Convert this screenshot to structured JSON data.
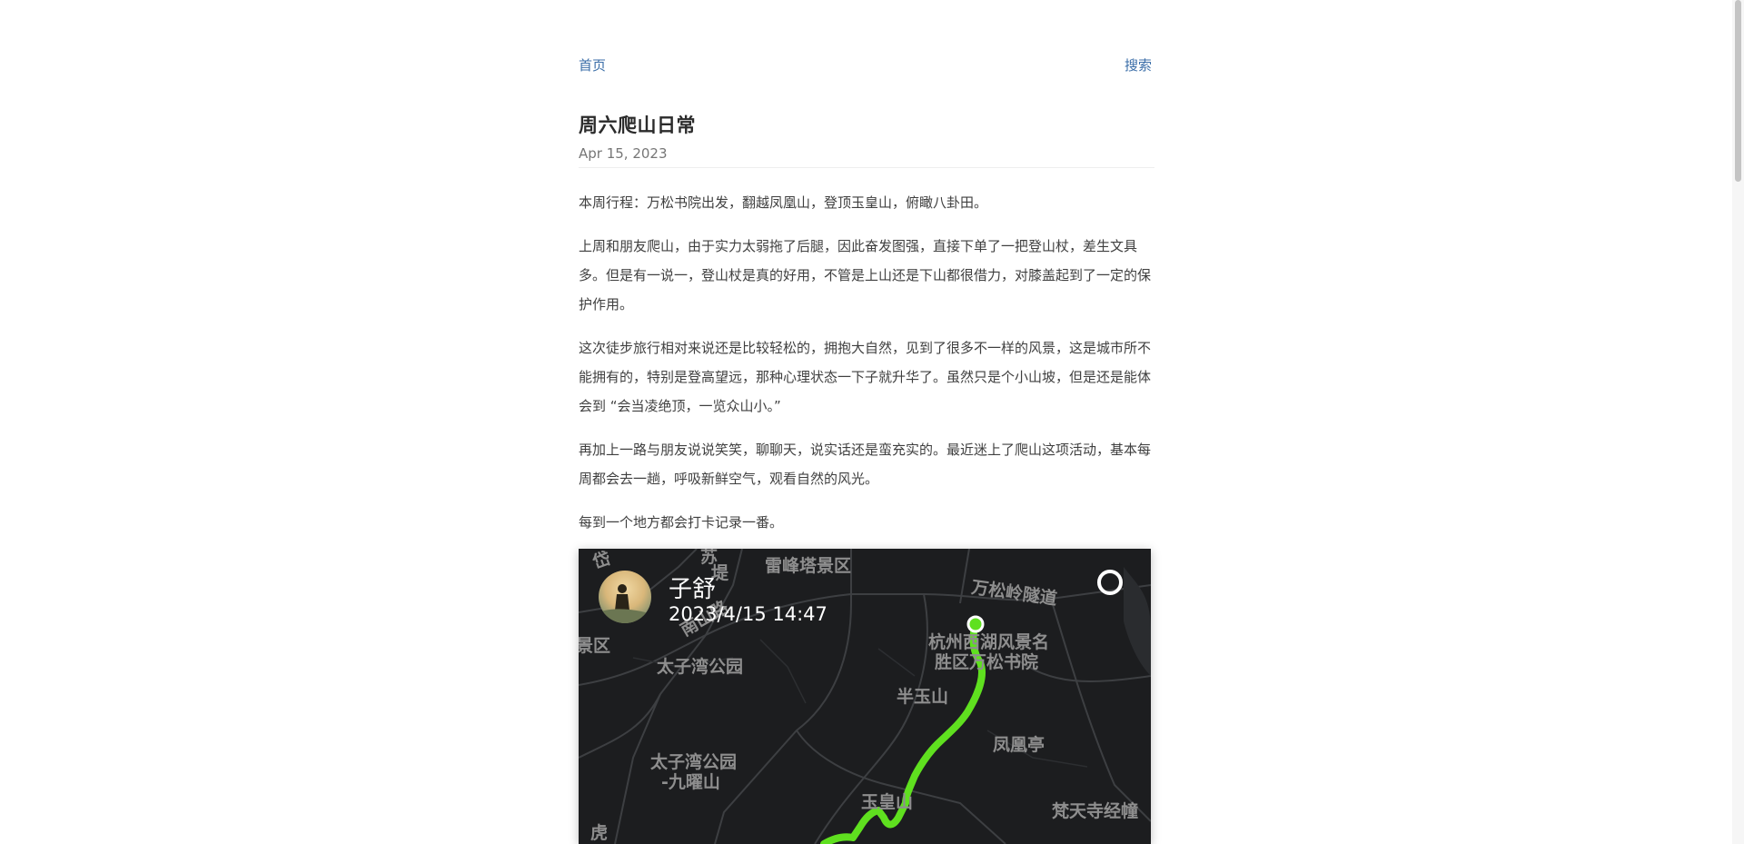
{
  "nav": {
    "home_label": "首页",
    "search_label": "搜索"
  },
  "post": {
    "title": "周六爬山日常",
    "date": "Apr 15, 2023",
    "paragraphs": [
      "本周行程：万松书院出发，翻越凤凰山，登顶玉皇山，俯瞰八卦田。",
      "上周和朋友爬山，由于实力太弱拖了后腿，因此奋发图强，直接下单了一把登山杖，差生文具多。但是有一说一，登山杖是真的好用，不管是上山还是下山都很借力，对膝盖起到了一定的保护作用。",
      "这次徒步旅行相对来说还是比较轻松的，拥抱大自然，见到了很多不一样的风景，这是城市所不能拥有的，特别是登高望远，那种心理状态一下子就升华了。虽然只是个小山坡，但是还是能体会到 “会当凌绝顶，一览众山小。”",
      "再加上一路与朋友说说笑笑，聊聊天，说实话还是蛮充实的。最近迷上了爬山这项活动，基本每周都会去一趟，呼吸新鲜空气，观看自然的风光。",
      "每到一个地方都会打卡记录一番。"
    ]
  },
  "map_card": {
    "user_name": "子舒",
    "timestamp": "2023/4/15 14:47",
    "route_color": "#5fe01f",
    "labels": {
      "leifeng": "雷峰塔景区",
      "wansongling": "万松岭隧道",
      "su": "苏",
      "di": "堤",
      "nanshan": "南山路",
      "jingqu": "景区",
      "taiziwan": "太子湾公园",
      "xihu_1": "杭州西湖风景名",
      "xihu_2": "胜区万松书院",
      "banyu": "半玉山",
      "fenghuang": "凤凰亭",
      "taiziwan2_1": "太子湾公园",
      "taiziwan2_2": "-九曜山",
      "yuhuang": "玉皇山",
      "fantian": "梵天寺经幢",
      "hu": "虎",
      "corner": "岱"
    }
  }
}
